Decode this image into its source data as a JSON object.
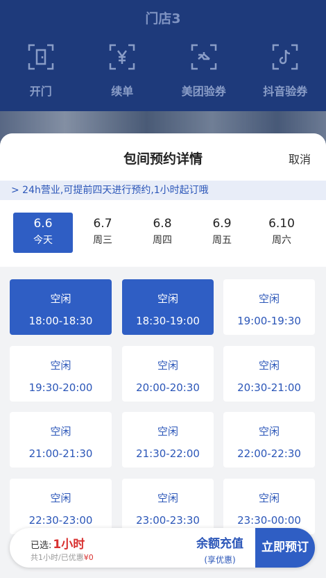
{
  "header": {
    "store_title": "门店3",
    "actions": [
      {
        "label": "开门",
        "icon": "door-icon"
      },
      {
        "label": "续单",
        "icon": "yen-icon"
      },
      {
        "label": "美团验券",
        "icon": "coupon-icon"
      },
      {
        "label": "抖音验券",
        "icon": "tiktok-icon"
      }
    ]
  },
  "sheet": {
    "title": "包间预约详情",
    "cancel": "取消",
    "notice": "> 24h营业,可提前四天进行预约,1小时起订哦",
    "dates": [
      {
        "date": "6.6",
        "week": "今天",
        "selected": true
      },
      {
        "date": "6.7",
        "week": "周三",
        "selected": false
      },
      {
        "date": "6.8",
        "week": "周四",
        "selected": false
      },
      {
        "date": "6.9",
        "week": "周五",
        "selected": false
      },
      {
        "date": "6.10",
        "week": "周六",
        "selected": false
      }
    ],
    "slots": [
      {
        "status": "空闲",
        "time": "18:00-18:30",
        "selected": true
      },
      {
        "status": "空闲",
        "time": "18:30-19:00",
        "selected": true
      },
      {
        "status": "空闲",
        "time": "19:00-19:30",
        "selected": false
      },
      {
        "status": "空闲",
        "time": "19:30-20:00",
        "selected": false
      },
      {
        "status": "空闲",
        "time": "20:00-20:30",
        "selected": false
      },
      {
        "status": "空闲",
        "time": "20:30-21:00",
        "selected": false
      },
      {
        "status": "空闲",
        "time": "21:00-21:30",
        "selected": false
      },
      {
        "status": "空闲",
        "time": "21:30-22:00",
        "selected": false
      },
      {
        "status": "空闲",
        "time": "22:00-22:30",
        "selected": false
      },
      {
        "status": "空闲",
        "time": "22:30-23:00",
        "selected": false
      },
      {
        "status": "空闲",
        "time": "23:00-23:30",
        "selected": false
      },
      {
        "status": "空闲",
        "time": "23:30-00:00",
        "selected": false
      }
    ]
  },
  "bottom": {
    "selected_prefix": "已选:",
    "selected_value": "1小时",
    "summary_prefix": "共1小时/已优惠",
    "summary_discount": "¥0",
    "recharge_label": "余额充值",
    "recharge_sub": "(享优惠)",
    "book_label": "立即预订"
  },
  "colors": {
    "header_bg": "#1e3a7b",
    "accent": "#2f5ec4",
    "price_red": "#d8302f"
  }
}
